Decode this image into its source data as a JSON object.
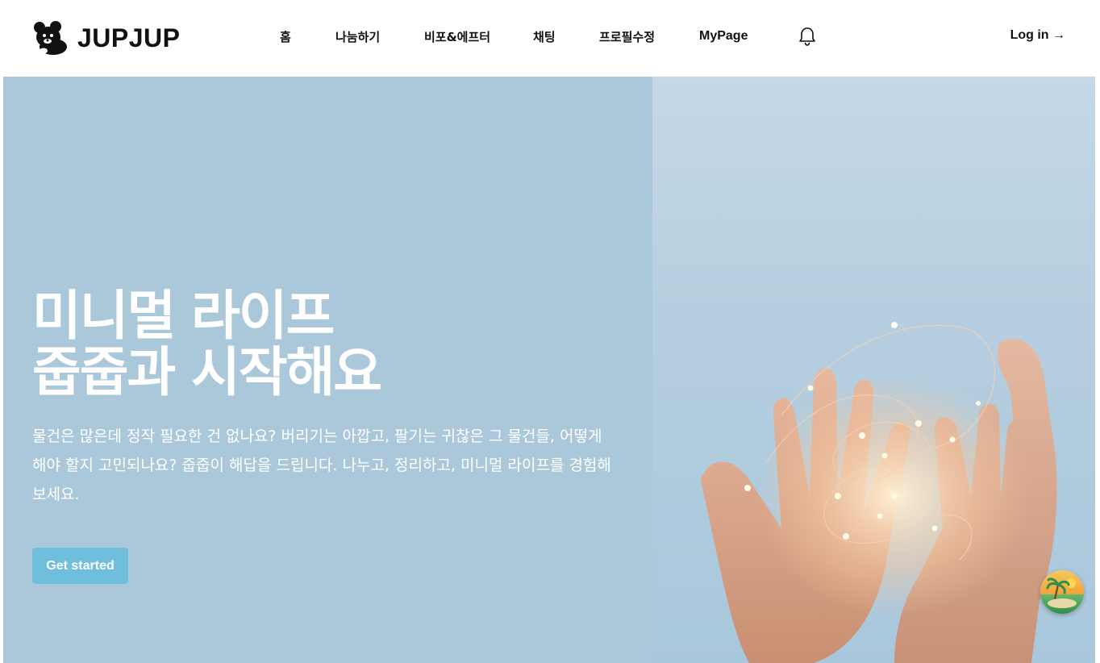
{
  "header": {
    "brand": "JUPJUP",
    "nav": [
      {
        "label": "홈"
      },
      {
        "label": "나눔하기"
      },
      {
        "label": "비포&에프터"
      },
      {
        "label": "채팅"
      },
      {
        "label": "프로필수정"
      },
      {
        "label": "MyPage"
      }
    ],
    "login_label": "Log in →",
    "icons": {
      "logo": "bear-logo-icon",
      "notification": "bell-icon"
    }
  },
  "hero": {
    "headline_line1": "미니멀 라이프",
    "headline_line2": "줍줍과 시작해요",
    "description": "물건은 많은데 정작 필요한 건 없나요? 버리기는 아깝고, 팔기는 귀찮은 그 물건들, 어떻게 해야 할지 고민되나요? 줍줍이 해답을 드립니다. 나누고, 정리하고, 미니멀 라이프를 경험해보세요.",
    "cta_label": "Get started",
    "image": "hands-holding-fairy-lights-photo"
  },
  "floating": {
    "icon": "island-chat-icon"
  },
  "colors": {
    "hero_bg": "#abc8da",
    "cta_bg": "#6fbfdc",
    "text_dark": "#111111",
    "text_light": "#ffffff"
  }
}
